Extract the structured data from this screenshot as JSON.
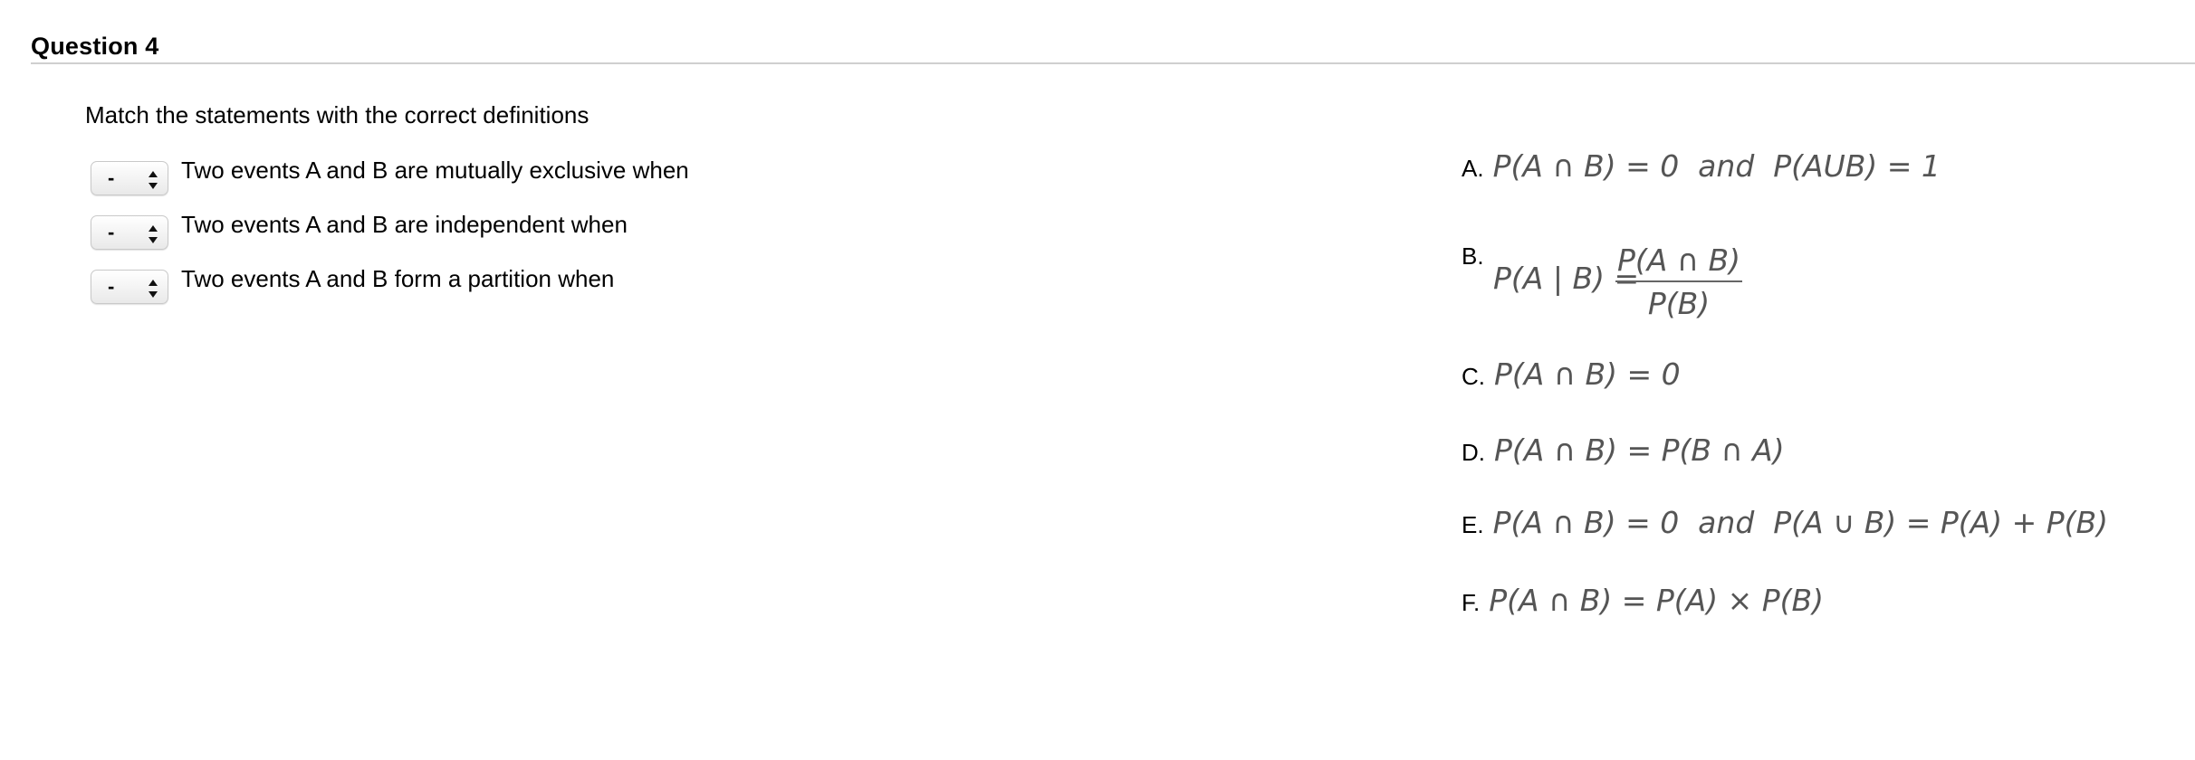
{
  "question": {
    "title": "Question 4",
    "instruction": "Match the statements with the correct definitions"
  },
  "statements": [
    {
      "selected": "-",
      "text": "Two events A and B are mutually exclusive when"
    },
    {
      "selected": "-",
      "text": "Two events A and B are independent when"
    },
    {
      "selected": "-",
      "text": "Two events A and B form a partition when"
    }
  ],
  "options": {
    "a": {
      "letter": "A.",
      "formula": "P(A ∩ B) = 0  and  P(AUB) = 1"
    },
    "b": {
      "letter": "B.",
      "lhs": "P(A | B) =",
      "numerator": "P(A ∩ B)",
      "denominator": "P(B)"
    },
    "c": {
      "letter": "C.",
      "formula": "P(A ∩ B) = 0"
    },
    "d": {
      "letter": "D.",
      "formula": "P(A ∩ B) = P(B ∩ A)"
    },
    "e": {
      "letter": "E.",
      "formula": "P(A ∩ B) = 0  and  P(A ∪ B) = P(A) + P(B)"
    },
    "f": {
      "letter": "F.",
      "formula": "P(A ∩ B) = P(A) × P(B)"
    }
  }
}
